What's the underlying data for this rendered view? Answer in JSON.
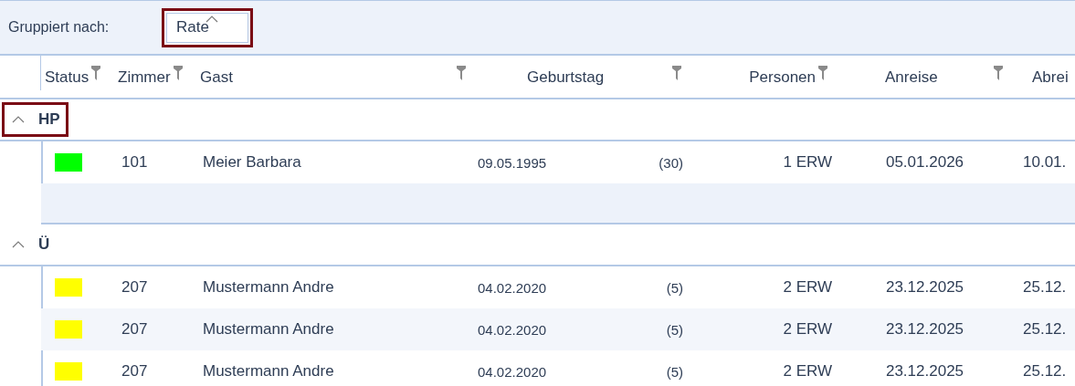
{
  "group_by": {
    "label": "Gruppiert nach:",
    "value": "Rate",
    "highlighted": true
  },
  "columns": [
    {
      "label": "Status",
      "filterable": true
    },
    {
      "label": "Zimmer",
      "filterable": true
    },
    {
      "label": "Gast",
      "filterable": true
    },
    {
      "label": "Geburtstag",
      "filterable": true
    },
    {
      "label": "Personen",
      "filterable": true
    },
    {
      "label": "Anreise",
      "filterable": true
    },
    {
      "label": "Abrei",
      "filterable": false
    }
  ],
  "groups": [
    {
      "title": "HP",
      "expanded": true,
      "highlighted": true,
      "summary_row": true,
      "rows": [
        {
          "color": "#00ff00",
          "room": "101",
          "guest": "Meier Barbara",
          "birthday": "09.05.1995",
          "age": "(30)",
          "persons": "1 ERW",
          "arrival": "05.01.2026",
          "departure": "10.01."
        }
      ]
    },
    {
      "title": "Ü",
      "expanded": true,
      "highlighted": false,
      "summary_row": false,
      "rows": [
        {
          "color": "#ffff00",
          "room": "207",
          "guest": "Mustermann Andre",
          "birthday": "04.02.2020",
          "age": "(5)",
          "persons": "2 ERW",
          "arrival": "23.12.2025",
          "departure": "25.12."
        },
        {
          "color": "#ffff00",
          "room": "207",
          "guest": "Mustermann Andre",
          "birthday": "04.02.2020",
          "age": "(5)",
          "persons": "2 ERW",
          "arrival": "23.12.2025",
          "departure": "25.12."
        },
        {
          "color": "#ffff00",
          "room": "207",
          "guest": "Mustermann Andre",
          "birthday": "04.02.2020",
          "age": "(5)",
          "persons": "2 ERW",
          "arrival": "23.12.2025",
          "departure": "25.12."
        }
      ]
    }
  ]
}
